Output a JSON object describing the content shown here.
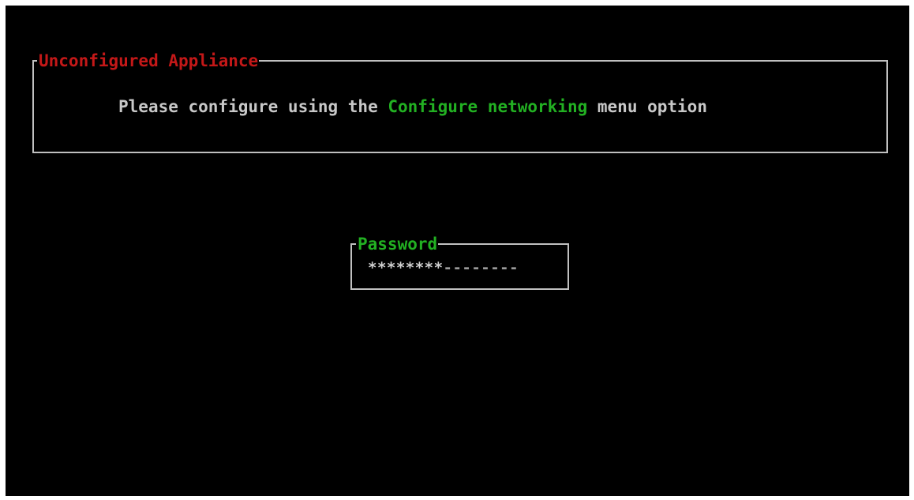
{
  "banner": {
    "title": "Unconfigured Appliance",
    "message_prefix": "Please configure using the ",
    "message_highlight": "Configure networking",
    "message_suffix": " menu option"
  },
  "password": {
    "label": "Password",
    "masked_value": "********",
    "remaining_placeholder": "--------"
  },
  "colors": {
    "background": "#000000",
    "border": "#c0c0c0",
    "warning_title": "#c41818",
    "highlight_green": "#22b022",
    "text": "#c8c8c8"
  }
}
